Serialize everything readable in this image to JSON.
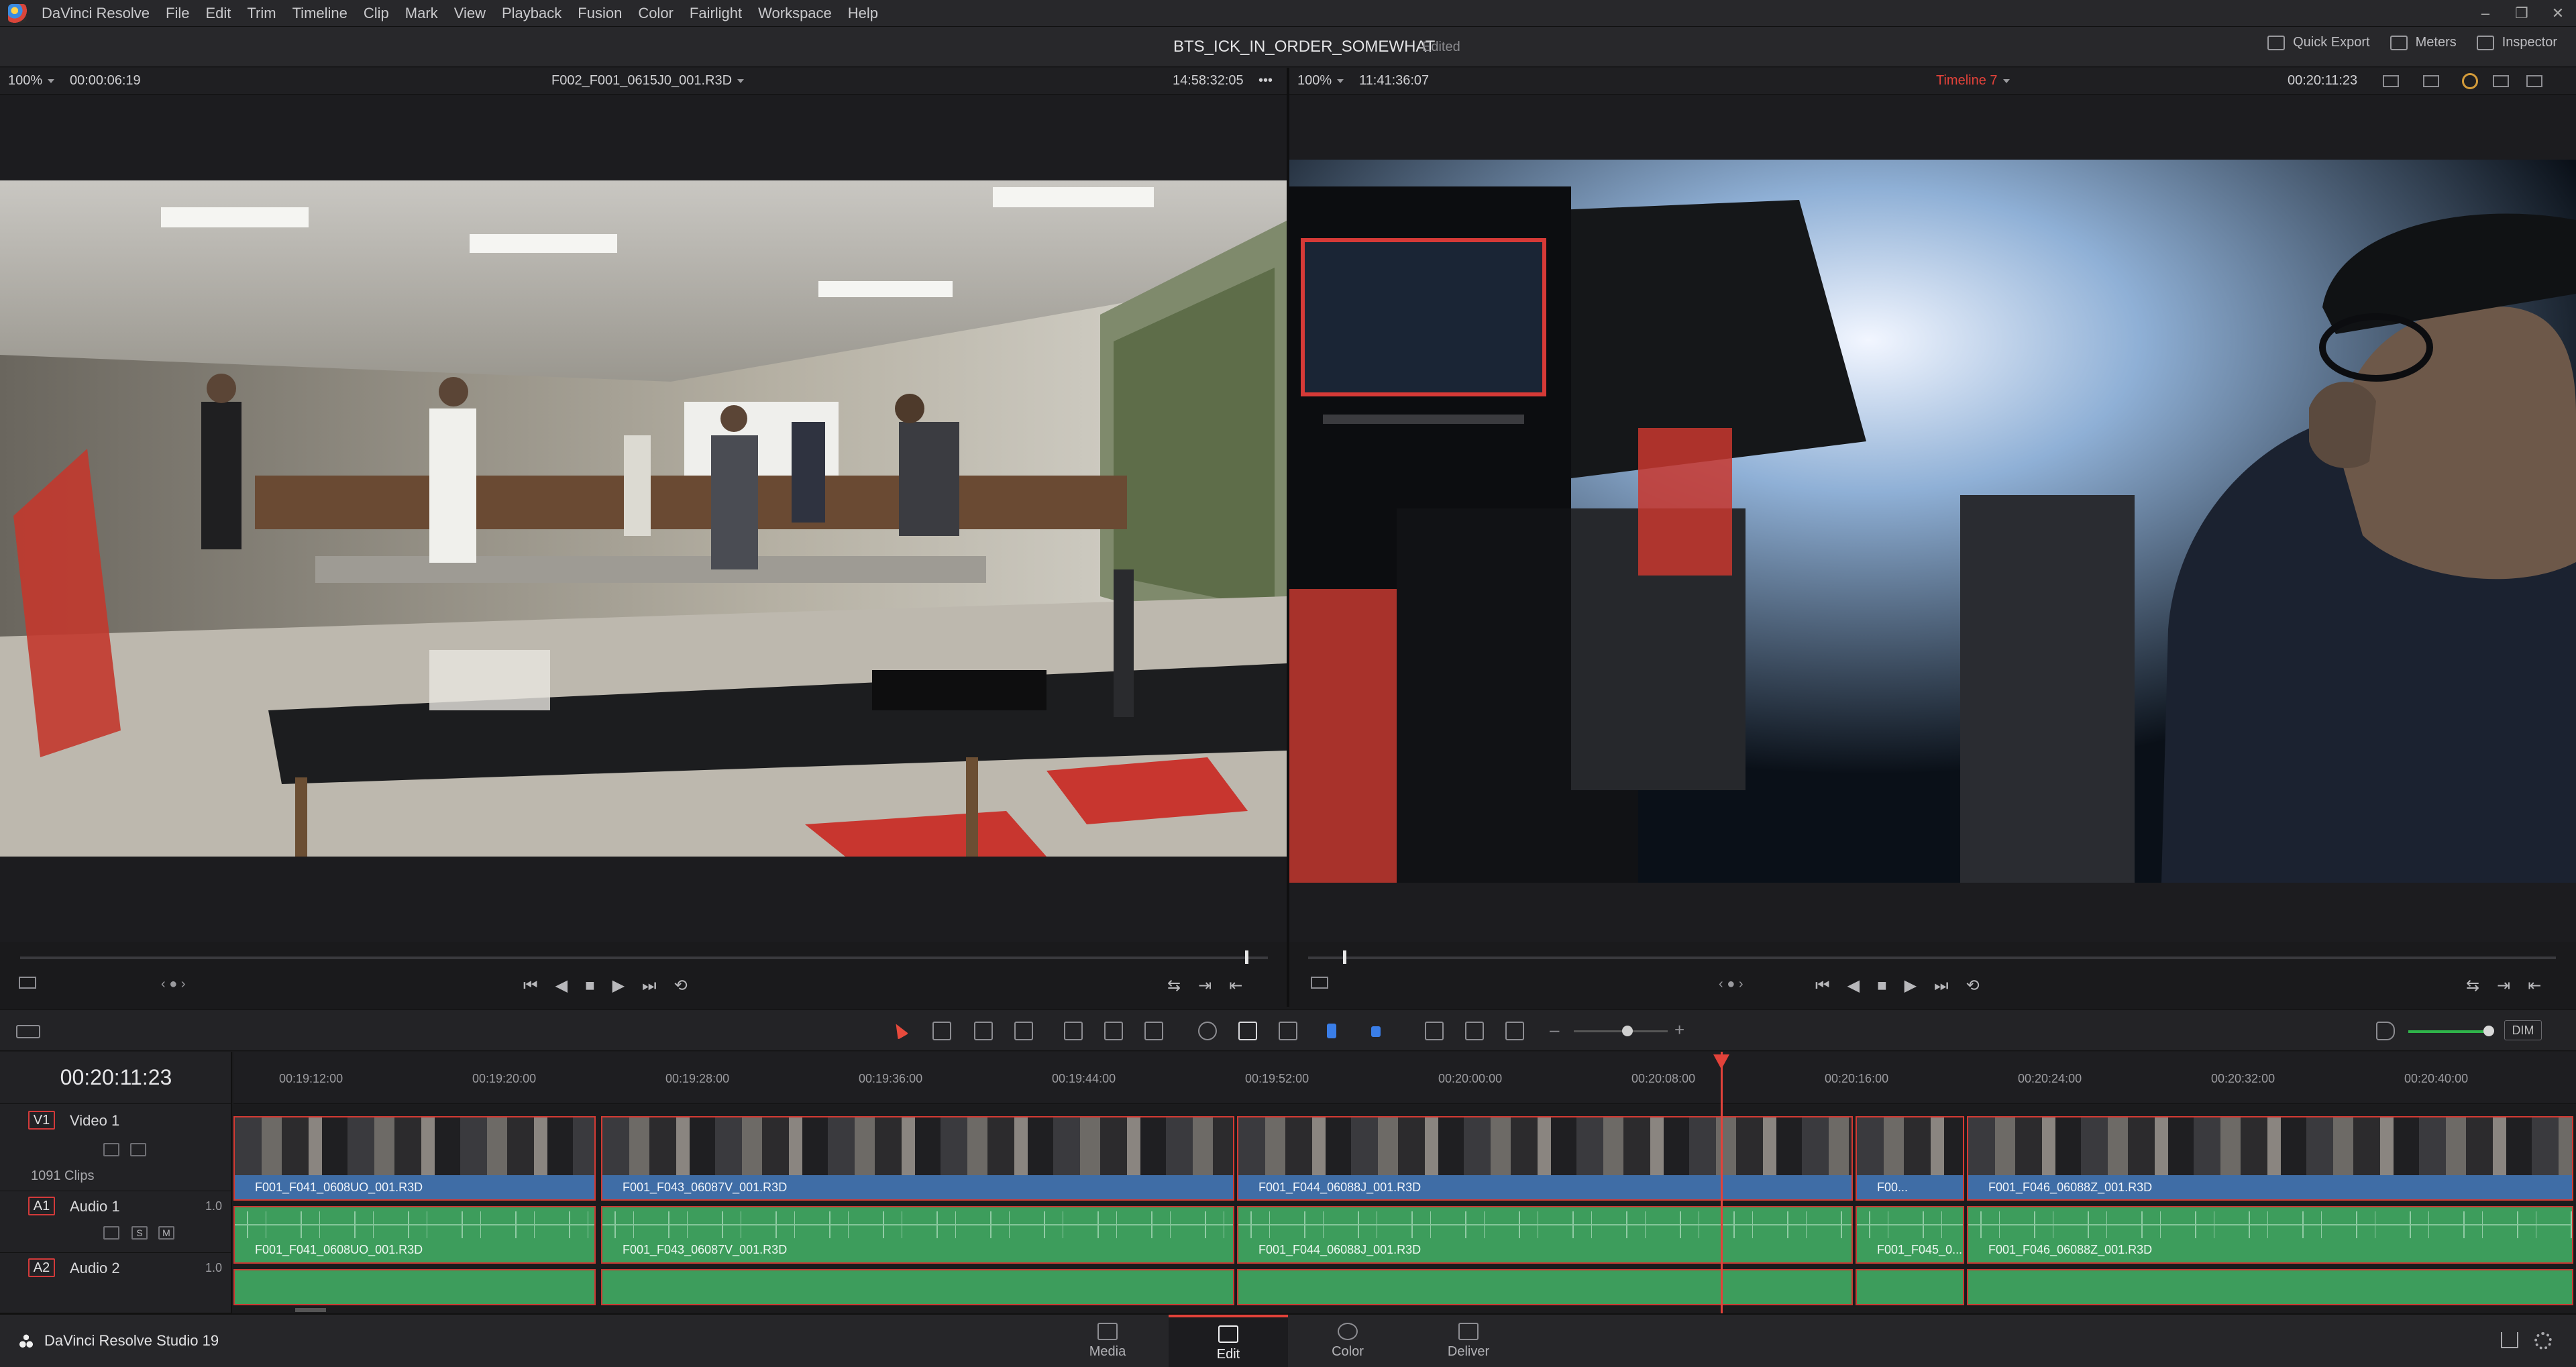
{
  "app": {
    "name": "DaVinci Resolve",
    "menu": [
      "File",
      "Edit",
      "Trim",
      "Timeline",
      "Clip",
      "Mark",
      "View",
      "Playback",
      "Fusion",
      "Color",
      "Fairlight",
      "Workspace",
      "Help"
    ]
  },
  "project": {
    "title": "BTS_ICK_IN_ORDER_SOMEWHAT",
    "status": "Edited",
    "quick_export": "Quick Export",
    "meters": "Meters",
    "inspector": "Inspector"
  },
  "source_viewer": {
    "zoom": "100%",
    "timecode_left": "00:00:06:19",
    "clip_name": "F002_F001_0615J0_001.R3D",
    "timecode_right": "14:58:32:05",
    "more": "•••"
  },
  "timeline_viewer": {
    "zoom": "100%",
    "timecode_left": "11:41:36:07",
    "timeline_name": "Timeline 7",
    "timecode_right": "00:20:11:23"
  },
  "timeline": {
    "current_timecode": "00:20:11:23",
    "ruler": [
      "00:19:12:00",
      "00:19:20:00",
      "00:19:28:00",
      "00:19:36:00",
      "00:19:44:00",
      "00:19:52:00",
      "00:20:00:00",
      "00:20:08:00",
      "00:20:16:00",
      "00:20:24:00",
      "00:20:32:00",
      "00:20:40:00"
    ],
    "tracks": {
      "v1": {
        "id": "V1",
        "name": "Video 1",
        "sub": "1091 Clips"
      },
      "a1": {
        "id": "A1",
        "name": "Audio 1",
        "vol": "1.0",
        "s": "S",
        "m": "M"
      },
      "a2": {
        "id": "A2",
        "name": "Audio 2",
        "vol": "1.0"
      }
    },
    "video_clips": [
      "F001_F041_0608UO_001.R3D",
      "F001_F043_06087V_001.R3D",
      "F001_F044_06088J_001.R3D",
      "F00...",
      "F001_F046_06088Z_001.R3D"
    ],
    "audio_clips": [
      "F001_F041_0608UO_001.R3D",
      "F001_F043_06087V_001.R3D",
      "F001_F044_06088J_001.R3D",
      "F001_F045_0...",
      "F001_F046_06088Z_001.R3D"
    ],
    "dim": "DIM"
  },
  "pages": {
    "brand": "DaVinci Resolve Studio 19",
    "tabs": [
      "Media",
      "Edit",
      "Color",
      "Deliver"
    ],
    "active": "Edit"
  },
  "colors": {
    "accent_red": "#e2423a",
    "video_clip_blue": "#3f6da6",
    "audio_clip_green": "#3d9d5c"
  }
}
